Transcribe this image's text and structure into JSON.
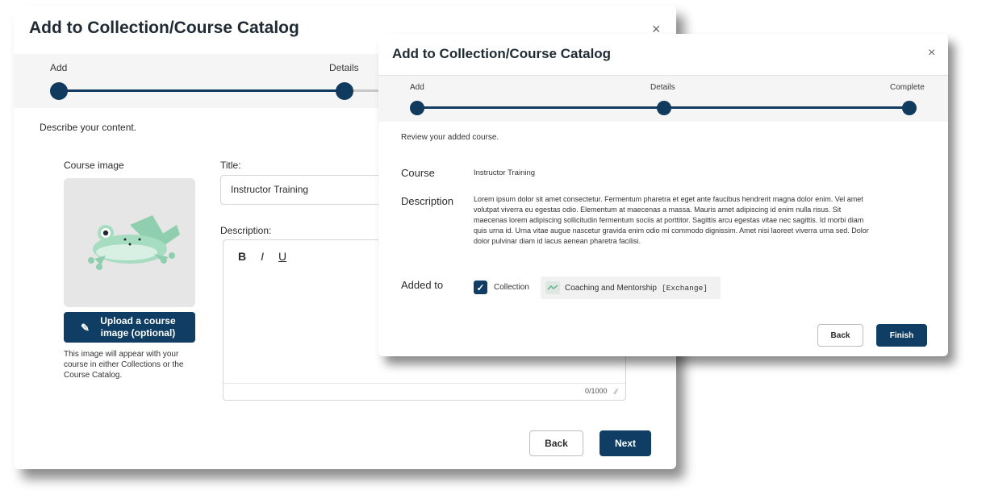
{
  "back_modal": {
    "title": "Add to Collection/Course Catalog",
    "close_label": "×",
    "steps": [
      "Add",
      "Details"
    ],
    "instruction": "Describe your content.",
    "course_image_label": "Course image",
    "upload_button_label": "Upload a course image (optional)",
    "upload_help": "This image will appear with your course in either Collections or the Course Catalog.",
    "title_label": "Title:",
    "title_value": "Instructor Training",
    "description_label": "Description:",
    "toolbar": {
      "bold": "B",
      "italic": "I",
      "underline": "U"
    },
    "char_counter": "0/1000",
    "back_label": "Back",
    "next_label": "Next"
  },
  "front_modal": {
    "title": "Add to Collection/Course Catalog",
    "close_label": "×",
    "steps": [
      "Add",
      "Details",
      "Complete"
    ],
    "instruction": "Review your added course.",
    "course_label": "Course",
    "course_value": "Instructor Training",
    "description_label": "Description",
    "description_value": "Lorem ipsum dolor sit amet consectetur. Fermentum pharetra et eget ante faucibus hendrerit magna dolor enim. Vel amet volutpat viverra eu egestas odio. Elementum at maecenas a massa. Mauris amet adipiscing id enim nulla risus. Sit maecenas lorem adipiscing sollicitudin fermentum sociis at porttitor. Sagittis arcu egestas vitae nec sagittis. Id morbi diam quis urna id. Urna vitae augue nascetur gravida enim odio mi commodo dignissim. Amet nisi laoreet viverra urna sed. Dolor dolor pulvinar diam id lacus aenean pharetra facilisi.",
    "added_to_label": "Added to",
    "collection_label": "Collection",
    "collection_checked": true,
    "collection_name": "Coaching and Mentorship",
    "collection_tag": "[Exchange]",
    "back_label": "Back",
    "finish_label": "Finish"
  },
  "colors": {
    "primary": "#0f3d63",
    "frog": "#8fcfb0",
    "image_bg": "#e6e6e6"
  },
  "icons": {
    "close": "close-icon",
    "pencil": "pencil-icon",
    "check": "check-icon",
    "collection": "collection-icon",
    "resize": "resize-handle-icon"
  }
}
